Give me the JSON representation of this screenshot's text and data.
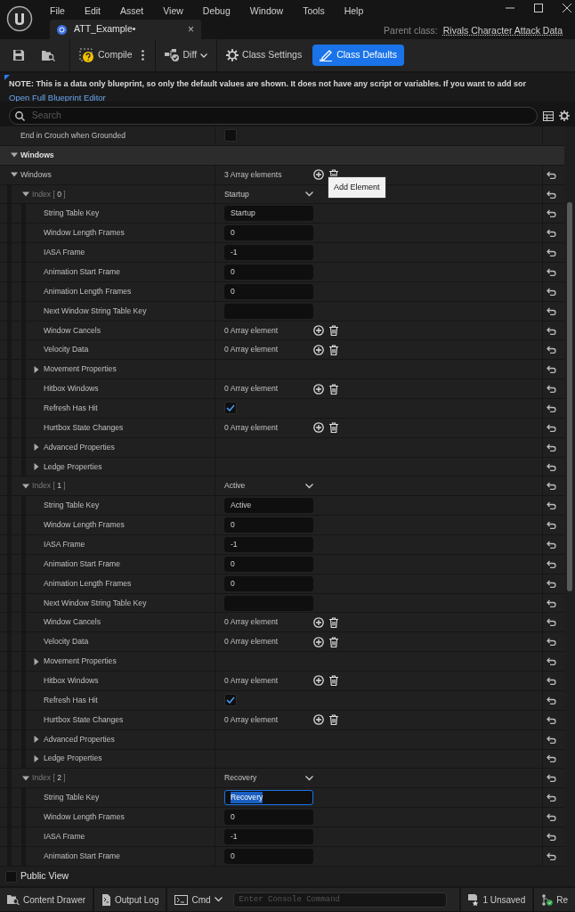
{
  "title_bar": {
    "menu": [
      "File",
      "Edit",
      "Asset",
      "View",
      "Debug",
      "Window",
      "Tools",
      "Help"
    ],
    "tab": {
      "title": "ATT_Example•",
      "close": "×"
    },
    "parent_class_label": "Parent class:",
    "parent_class": "Rivals Character Attack Data"
  },
  "toolbar": [
    {
      "kind": "save"
    },
    {
      "kind": "browse"
    },
    {
      "kind": "compile",
      "label": "Compile",
      "selected": false
    },
    {
      "kind": "diff",
      "label": "Diff",
      "selected": false
    },
    {
      "kind": "settings",
      "label": "Class Settings",
      "selected": false
    },
    {
      "kind": "defaults",
      "label": "Class Defaults",
      "selected": true
    }
  ],
  "notice": {
    "text": "NOTE: This is a data only blueprint, so only the default values are shown.  It does not have any script or variables.  If you want to add sor",
    "link": "Open Full Blueprint Editor"
  },
  "search": {
    "placeholder": "Search"
  },
  "properties": [
    {
      "kind": "bool",
      "label": "End in Crouch when Grounded",
      "checked": false,
      "reset": false
    },
    {
      "kind": "category",
      "label": "Windows",
      "expanded": true,
      "children": [
        {
          "kind": "array",
          "label": "Windows",
          "value": "3 Array elements",
          "expanded": true,
          "reset": true,
          "tooltip": "Add Element",
          "children": [
            {
              "kind": "index",
              "label": "Index [ **0** ]",
              "value": "Startup",
              "expanded": true,
              "reset": true,
              "children": [
                {
                  "kind": "field",
                  "label": "String Table Key",
                  "value": "Startup",
                  "text_selected": false,
                  "reset": true
                },
                {
                  "kind": "field",
                  "label": "Window Length Frames",
                  "value": "0",
                  "text_selected": false,
                  "reset": true
                },
                {
                  "kind": "field",
                  "label": "IASA Frame",
                  "value": "-1",
                  "text_selected": false,
                  "reset": true
                },
                {
                  "kind": "field",
                  "label": "Animation Start Frame",
                  "value": "0",
                  "text_selected": false,
                  "reset": true
                },
                {
                  "kind": "field",
                  "label": "Animation Length Frames",
                  "value": "0",
                  "text_selected": false,
                  "reset": true
                },
                {
                  "kind": "field",
                  "label": "Next Window String Table Key",
                  "text_selected": false,
                  "reset": true
                },
                {
                  "kind": "array",
                  "label": "Window Cancels",
                  "value": "0 Array element",
                  "reset": true
                },
                {
                  "kind": "array",
                  "label": "Velocity Data",
                  "value": "0 Array element",
                  "reset": true
                },
                {
                  "kind": "struct",
                  "label": "Movement Properties",
                  "expanded": false,
                  "reset": true
                },
                {
                  "kind": "array",
                  "label": "Hitbox Windows",
                  "value": "0 Array element",
                  "reset": true
                },
                {
                  "kind": "bool",
                  "label": "Refresh Has Hit",
                  "checked": true,
                  "reset": true
                },
                {
                  "kind": "array",
                  "label": "Hurtbox State Changes",
                  "value": "0 Array element",
                  "reset": true
                },
                {
                  "kind": "struct",
                  "label": "Advanced Properties",
                  "expanded": false,
                  "reset": true
                },
                {
                  "kind": "struct",
                  "label": "Ledge Properties",
                  "expanded": false,
                  "reset": true
                }
              ]
            },
            {
              "kind": "index",
              "label": "Index [ **1** ]",
              "value": "Active",
              "expanded": true,
              "reset": true,
              "children": [
                {
                  "kind": "field",
                  "label": "String Table Key",
                  "value": "Active",
                  "text_selected": false,
                  "reset": true
                },
                {
                  "kind": "field",
                  "label": "Window Length Frames",
                  "value": "0",
                  "text_selected": false,
                  "reset": true
                },
                {
                  "kind": "field",
                  "label": "IASA Frame",
                  "value": "-1",
                  "text_selected": false,
                  "reset": true
                },
                {
                  "kind": "field",
                  "label": "Animation Start Frame",
                  "value": "0",
                  "text_selected": false,
                  "reset": true
                },
                {
                  "kind": "field",
                  "label": "Animation Length Frames",
                  "value": "0",
                  "text_selected": false,
                  "reset": true
                },
                {
                  "kind": "field",
                  "label": "Next Window String Table Key",
                  "text_selected": false,
                  "reset": true
                },
                {
                  "kind": "array",
                  "label": "Window Cancels",
                  "value": "0 Array element",
                  "reset": true
                },
                {
                  "kind": "array",
                  "label": "Velocity Data",
                  "value": "0 Array element",
                  "reset": true
                },
                {
                  "kind": "struct",
                  "label": "Movement Properties",
                  "expanded": false,
                  "reset": true
                },
                {
                  "kind": "array",
                  "label": "Hitbox Windows",
                  "value": "0 Array element",
                  "reset": true
                },
                {
                  "kind": "bool",
                  "label": "Refresh Has Hit",
                  "checked": true,
                  "reset": true
                },
                {
                  "kind": "array",
                  "label": "Hurtbox State Changes",
                  "value": "0 Array element",
                  "reset": true
                },
                {
                  "kind": "struct",
                  "label": "Advanced Properties",
                  "expanded": false,
                  "reset": true
                },
                {
                  "kind": "struct",
                  "label": "Ledge Properties",
                  "expanded": false,
                  "reset": true
                }
              ]
            },
            {
              "kind": "index",
              "label": "Index [ **2** ]",
              "value": "Recovery",
              "expanded": true,
              "reset": true,
              "children": [
                {
                  "kind": "field",
                  "label": "String Table Key",
                  "value": "Recovery",
                  "text_selected": true,
                  "reset": true
                },
                {
                  "kind": "field",
                  "label": "Window Length Frames",
                  "value": "0",
                  "text_selected": false,
                  "reset": true
                },
                {
                  "kind": "field",
                  "label": "IASA Frame",
                  "value": "-1",
                  "text_selected": false,
                  "reset": true
                },
                {
                  "kind": "field",
                  "label": "Animation Start Frame",
                  "value": "0",
                  "text_selected": false,
                  "reset": true
                }
              ]
            }
          ]
        }
      ]
    }
  ],
  "public_view": {
    "label": "Public View",
    "checked": false
  },
  "status_bar": {
    "content_drawer": "Content Drawer",
    "output_log": "Output Log",
    "cmd": "Cmd",
    "console_placeholder": "Enter Console Command",
    "unsaved": "1 Unsaved",
    "revision": "Re"
  }
}
